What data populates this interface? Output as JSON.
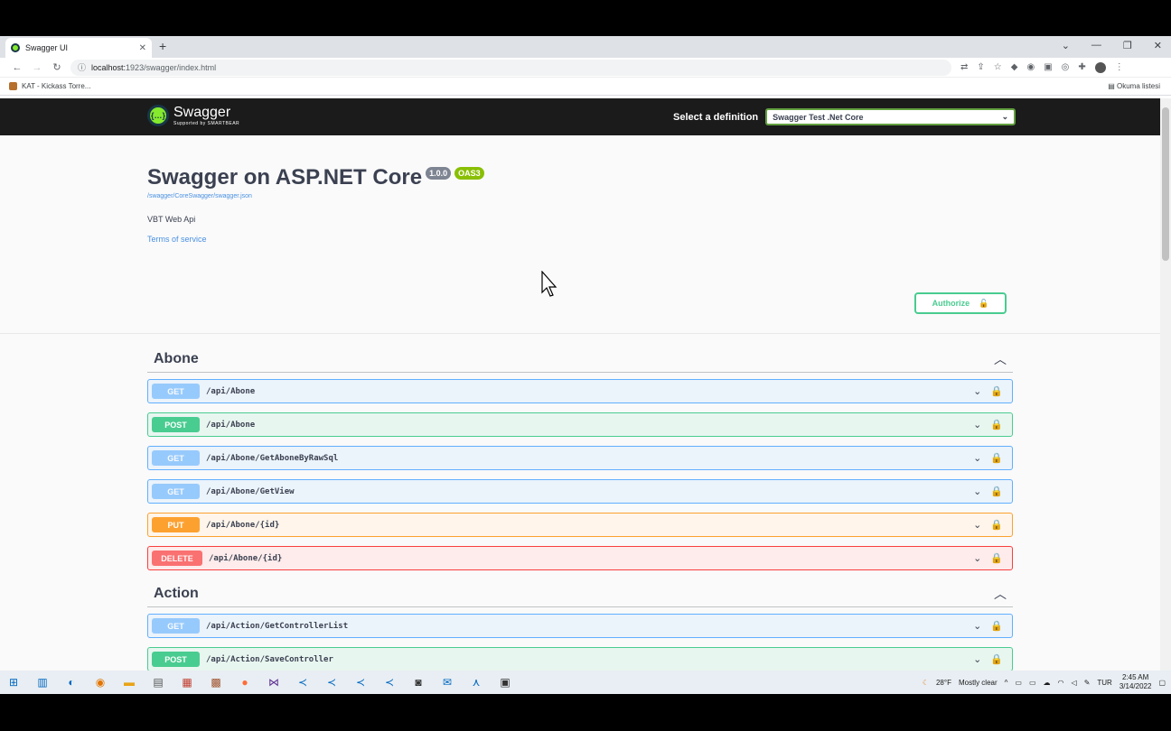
{
  "browser": {
    "tab_title": "Swagger UI",
    "url_host": "localhost:",
    "url_rest": "1923/swagger/index.html",
    "bookmark": "KAT - Kickass Torre...",
    "reading_list": "Okuma listesi"
  },
  "topbar": {
    "logo_text": "Swagger",
    "logo_sub": "Supported by SMARTBEAR",
    "definition_label": "Select a definition",
    "definition_value": "Swagger Test .Net Core"
  },
  "info": {
    "title": "Swagger on ASP.NET Core",
    "version": "1.0.0",
    "oas": "OAS3",
    "json_link": "/swagger/CoreSwagger/swagger.json",
    "description": "VBT Web Api",
    "terms": "Terms of service",
    "authorize": "Authorize"
  },
  "tags": [
    {
      "name": "Abone",
      "ops": [
        {
          "method": "GET",
          "path": "/api/Abone"
        },
        {
          "method": "POST",
          "path": "/api/Abone"
        },
        {
          "method": "GET",
          "path": "/api/Abone/GetAboneByRawSql"
        },
        {
          "method": "GET",
          "path": "/api/Abone/GetView"
        },
        {
          "method": "PUT",
          "path": "/api/Abone/{id}"
        },
        {
          "method": "DELETE",
          "path": "/api/Abone/{id}"
        }
      ]
    },
    {
      "name": "Action",
      "ops": [
        {
          "method": "GET",
          "path": "/api/Action/GetControllerList"
        },
        {
          "method": "POST",
          "path": "/api/Action/SaveController"
        }
      ]
    }
  ],
  "taskbar": {
    "weather": "28°F",
    "weather_text": "Mostly clear",
    "lang": "TUR",
    "time": "2:45 AM",
    "date": "3/14/2022"
  },
  "colors": {
    "get": "#61affe",
    "post": "#49cc90",
    "put": "#fca130",
    "delete": "#f93e3e",
    "topbar": "#1b1b1b"
  }
}
